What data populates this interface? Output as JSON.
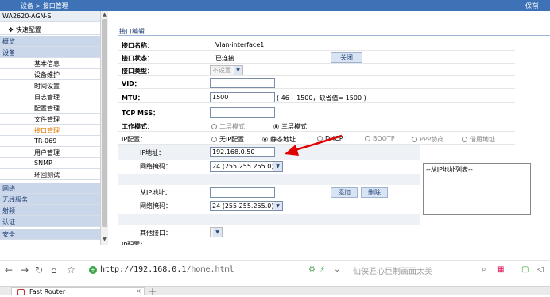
{
  "topbar": {
    "breadcrumb": "设备 > 接口管理",
    "save": "保存"
  },
  "sidebar": {
    "device_model": "WA2620-AGN-S",
    "quick_config": "快速配置",
    "categories": [
      "概览",
      "设备",
      "网络",
      "无线服务",
      "射频",
      "认证",
      "安全"
    ],
    "device_subitems": [
      "基本信息",
      "设备维护",
      "时间设置",
      "日志管理",
      "配置管理",
      "文件管理",
      "接口管理",
      "TR-069",
      "用户管理",
      "SNMP",
      "环回测试"
    ],
    "active_item": "接口管理"
  },
  "main": {
    "section_title": "接口编辑",
    "labels": {
      "name": "接口名称：",
      "state": "接口状态：",
      "type": "接口类型：",
      "vid": "VID：",
      "mtu": "MTU：",
      "tcp_mss": "TCP MSS：",
      "work_mode": "工作模式：",
      "ip_config": "IP配置：",
      "ip_addr": "IP地址：",
      "netmask": "网络掩码：",
      "secondary_ip": "从IP地址：",
      "netmask2": "网络掩码：",
      "other_iface": "其他接口："
    },
    "values": {
      "name": "Vlan-interface1",
      "state": "已连接",
      "type": "不设置",
      "vid": "",
      "mtu": "1500",
      "mtu_hint": "( 46~ 1500，缺省值= 1500 )",
      "tcp_mss": "",
      "ip_addr": "192.168.0.50",
      "netmask": "24 (255.255.255.0)",
      "secondary_ip": "",
      "netmask2": "24 (255.255.255.0)",
      "other_iface": ""
    },
    "buttons": {
      "close": "关闭",
      "add": "添加",
      "delete": "删除"
    },
    "work_mode_options": [
      "二层模式",
      "三层模式"
    ],
    "work_mode_selected": "三层模式",
    "ip_options": [
      "无IP配置",
      "静态地址",
      "DHCP",
      "BOOTP",
      "PPP协商",
      "借用地址"
    ],
    "ip_selected": "静态地址",
    "secondary_list_title": "--从IP地址列表--"
  },
  "browser": {
    "url_host": "http://192.168.0.1",
    "url_path": "/home.html",
    "search_text": "仙侠匠心巨制画面太美",
    "tab_title": "Fast Router"
  },
  "colors": {
    "topbar": "#3e72b6",
    "category": "#cad7ea",
    "arrow": "#e00000"
  }
}
